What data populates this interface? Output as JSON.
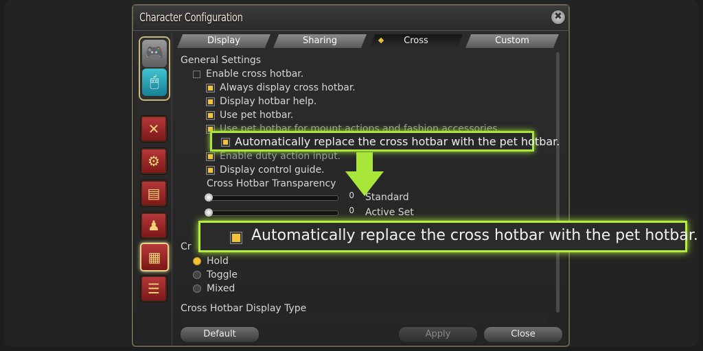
{
  "window": {
    "title": "Character Configuration",
    "close_glyph": "✖"
  },
  "tabs": [
    {
      "label": "Display",
      "active": false
    },
    {
      "label": "Sharing",
      "active": false
    },
    {
      "label": "Cross",
      "active": true
    },
    {
      "label": "Custom",
      "active": false
    }
  ],
  "general": {
    "section": "General Settings",
    "enable_cross": "Enable cross hotbar.",
    "always_display": "Always display cross hotbar.",
    "display_help": "Display hotbar help.",
    "use_pet": "Use pet hotbar.",
    "use_pet_mount": "Use pet hotbar for mount actions and fashion accessories.",
    "auto_replace": "Automatically replace the cross hotbar with the pet hotbar.",
    "enable_duty": "Enable duty action input.",
    "control_guide": "Display control guide.",
    "transparency_label": "Cross Hotbar Transparency",
    "slider_standard": {
      "value": "0",
      "label": "Standard"
    },
    "slider_active": {
      "value": "0",
      "label": "Active Set"
    }
  },
  "mode": {
    "section_partial": "Cr",
    "options": [
      "Hold",
      "Toggle",
      "Mixed"
    ],
    "selected": "Hold"
  },
  "display_type": {
    "section": "Cross Hotbar Display Type"
  },
  "buttons": {
    "default": "Default",
    "apply": "Apply",
    "close": "Close"
  },
  "callout": {
    "text": "Automatically replace the cross hotbar with the pet hotbar."
  },
  "colors": {
    "highlight": "#a8e63a",
    "check_on": "#f2c23a"
  }
}
